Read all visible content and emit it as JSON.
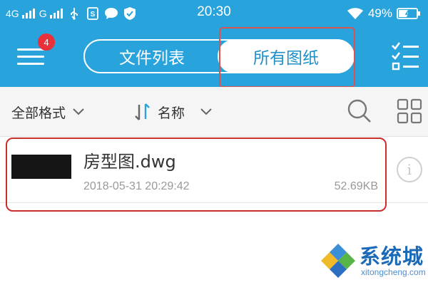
{
  "status_bar": {
    "sim1_label": "4G",
    "sim2_label": "G",
    "time": "20:30",
    "battery": "49%"
  },
  "header": {
    "menu_badge": "4",
    "tabs": [
      {
        "label": "文件列表",
        "selected": false
      },
      {
        "label": "所有图纸",
        "selected": true
      }
    ]
  },
  "toolbar": {
    "filter_label": "全部格式",
    "sort_label": "名称"
  },
  "files": [
    {
      "name": "房型图.dwg",
      "date": "2018-05-31 20:29:42",
      "size": "52.69KB"
    }
  ],
  "watermark": {
    "title": "系统城",
    "subtitle": "xitongcheng.com"
  },
  "colors": {
    "header_blue": "#29a3dc",
    "badge_red": "#e8313a",
    "highlight_red": "#c9302c"
  }
}
